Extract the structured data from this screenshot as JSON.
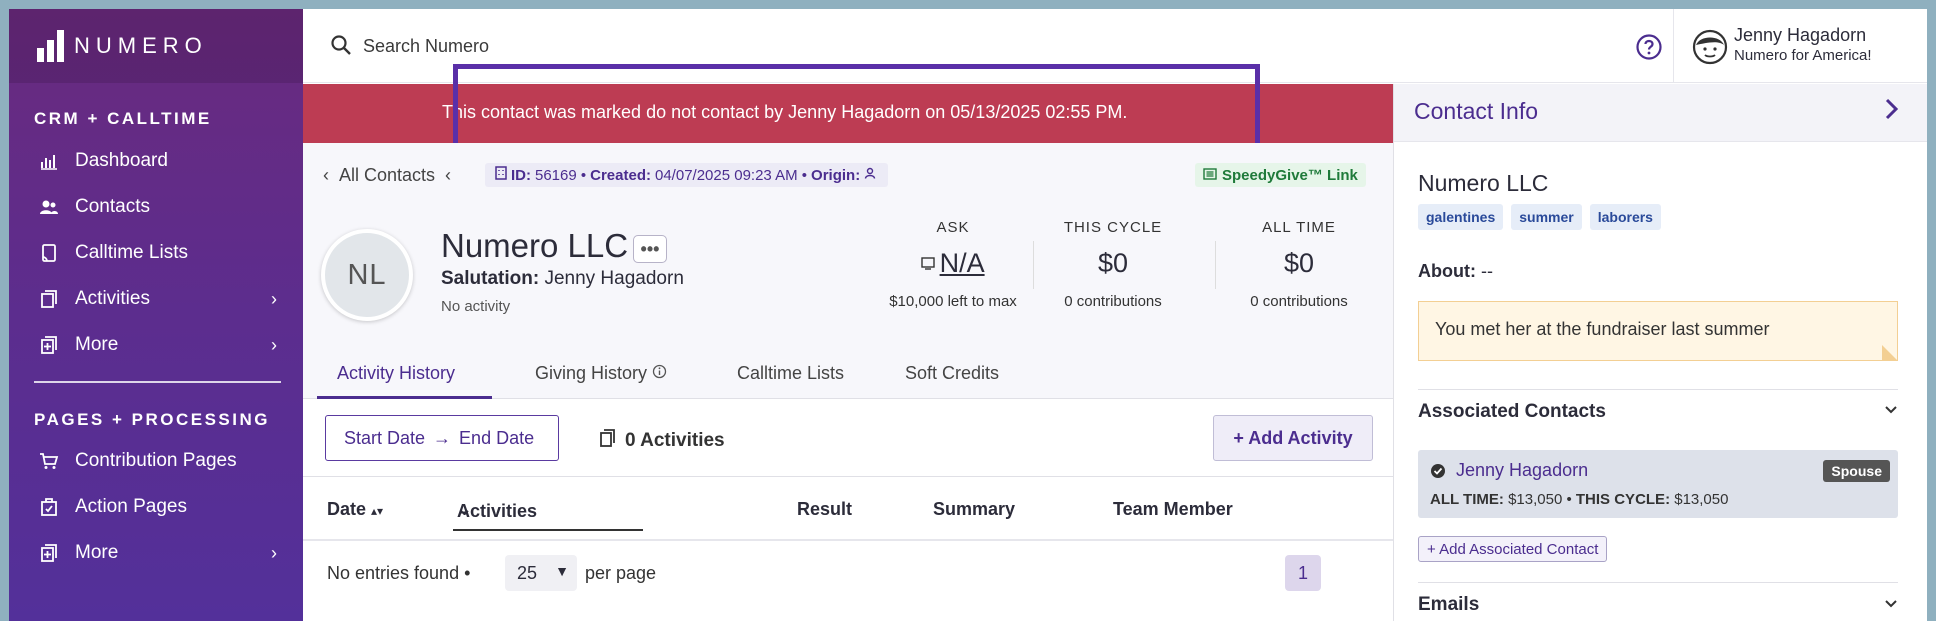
{
  "brand": {
    "name": "NUMERO"
  },
  "sidebar": {
    "section1": "CRM + CALLTIME",
    "section2": "PAGES + PROCESSING",
    "items": [
      {
        "label": "Dashboard",
        "icon": "dashboard-icon"
      },
      {
        "label": "Contacts",
        "icon": "contacts-icon"
      },
      {
        "label": "Calltime Lists",
        "icon": "calltime-lists-icon"
      },
      {
        "label": "Activities",
        "icon": "activities-icon",
        "chevron": "›"
      },
      {
        "label": "More",
        "icon": "more-icon",
        "chevron": "›"
      },
      {
        "label": "Contribution Pages",
        "icon": "cart-icon"
      },
      {
        "label": "Action Pages",
        "icon": "action-pages-icon"
      },
      {
        "label": "More",
        "icon": "more-icon",
        "chevron": "›"
      }
    ]
  },
  "search": {
    "placeholder": "Search Numero"
  },
  "user": {
    "name": "Jenny Hagadorn",
    "org": "Numero for America!"
  },
  "alert": {
    "message": "This contact was marked do not contact by Jenny Hagadorn on 05/13/2025 02:55 PM."
  },
  "breadcrumb": {
    "all_contacts": "All Contacts"
  },
  "meta": {
    "id_label": "ID:",
    "id_value": "56169 •",
    "created_label": "Created:",
    "created_value": "04/07/2025 09:23 AM •",
    "origin_label": "Origin:"
  },
  "speedygive": {
    "label": "SpeedyGive™ Link"
  },
  "contact": {
    "initials": "NL",
    "name": "Numero LLC",
    "salutation_label": "Salutation:",
    "salutation_value": "Jenny Hagadorn",
    "activity_status": "No activity"
  },
  "stats": {
    "ask": {
      "label": "ASK",
      "value": "N/A",
      "sub": "$10,000 left to max"
    },
    "this_cycle": {
      "label": "THIS CYCLE",
      "value": "$0",
      "sub": "0 contributions"
    },
    "all_time": {
      "label": "ALL TIME",
      "value": "$0",
      "sub": "0 contributions"
    }
  },
  "tabs": [
    "Activity History",
    "Giving History",
    "Calltime Lists",
    "Soft Credits"
  ],
  "toolbar": {
    "start_date": "Start Date",
    "end_date": "End Date",
    "activity_count": "0 Activities",
    "add_activity": "+ Add Activity"
  },
  "table": {
    "columns": [
      "Date",
      "Activities",
      "Result",
      "Summary",
      "Team Member"
    ],
    "empty": "No entries found •",
    "per_page_value": "25",
    "per_page_label": "per page",
    "page": "1"
  },
  "panel": {
    "title": "Contact Info",
    "name": "Numero LLC",
    "tags": [
      "galentines",
      "summer",
      "laborers"
    ],
    "about_label": "About:",
    "about_value": "--",
    "note": "You met her at the fundraiser last summer",
    "associated_title": "Associated Contacts",
    "associated": {
      "name": "Jenny Hagadorn",
      "relation": "Spouse",
      "all_time_label": "ALL TIME:",
      "all_time_value": "$13,050",
      "this_cycle_label": "THIS CYCLE:",
      "this_cycle_value": "$13,050"
    },
    "add_associated": "+ Add Associated Contact",
    "emails_title": "Emails"
  },
  "colors": {
    "accent": "#4b2d8f",
    "alert": "#bd3c53",
    "sidebar": "#5c2d8e"
  }
}
